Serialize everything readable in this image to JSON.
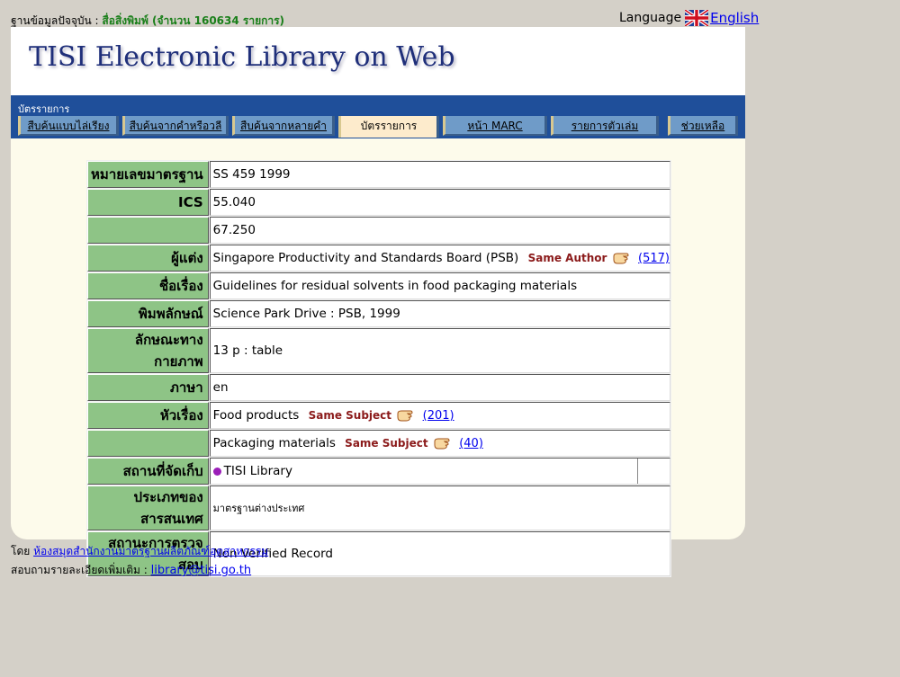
{
  "header": {
    "db_prefix": "ฐานข้อมูลปัจจุบัน :",
    "db_name": "สื่อสิ่งพิมพ์ (จำนวน 160634 รายการ)",
    "language_label": "Language",
    "language_link": "English"
  },
  "banner": {
    "title": "TISI Electronic Library on Web"
  },
  "nav": {
    "section_label": "บัตรรายการ",
    "tabs": [
      {
        "label": "สืบค้นแบบไล่เรียง"
      },
      {
        "label": "สืบค้นจากคำหรือวลี"
      },
      {
        "label": "สืบค้นจากหลายคำ"
      },
      {
        "label": "บัตรรายการ"
      },
      {
        "label": "หน้า MARC"
      },
      {
        "label": "รายการตัวเล่ม"
      },
      {
        "label": "ช่วยเหลือ"
      }
    ]
  },
  "record": {
    "rows": [
      {
        "label": "หมายเลขมาตรฐาน",
        "value": "SS 459 1999"
      },
      {
        "label": "ICS",
        "value": "55.040"
      },
      {
        "label": "",
        "value": "67.250"
      },
      {
        "label": "ผู้แต่ง",
        "value": "Singapore Productivity and Standards Board (PSB)",
        "same_label": "Same Author",
        "count": "(517)"
      },
      {
        "label": "ชื่อเรื่อง",
        "value": "Guidelines for residual solvents in food packaging materials"
      },
      {
        "label": "พิมพลักษณ์",
        "value": "Science Park Drive : PSB, 1999"
      },
      {
        "label": "ลักษณะทางกายภาพ",
        "value": "13 p : table"
      },
      {
        "label": "ภาษา",
        "value": "en"
      },
      {
        "label": "หัวเรื่อง",
        "value": "Food products",
        "same_label": "Same Subject",
        "count": "(201)"
      },
      {
        "label": "",
        "value": "Packaging materials",
        "same_label": "Same Subject",
        "count": "(40)"
      },
      {
        "label": "สถานที่จัดเก็บ",
        "value": "TISI Library"
      },
      {
        "label": "ประเภทของสารสนเทศ",
        "value": "มาตรฐานต่างประเทศ"
      },
      {
        "label": "สถานะการตรวจสอบ",
        "value": "Non Verified Record"
      }
    ]
  },
  "footer": {
    "by_prefix": "โดย",
    "org_link": "ห้องสมุดสำนักงานมาตรฐานผลิตภัณฑ์อุตสาหกรรม",
    "contact_prefix": "สอบถามรายละเอียดเพิ่มเติม :",
    "email_link": "library@tisi.go.th"
  },
  "colors": {
    "label_green": "#8ec486",
    "nav_blue": "#1f4f9a",
    "tab_blue": "#6f9bc8",
    "title_navy": "#1f2f7a",
    "frame_cream": "#fdfbeb"
  },
  "icons": {
    "flag": "uk-flag-icon",
    "hand": "pointing-hand-icon",
    "bullet": "purple-bullet-icon"
  }
}
